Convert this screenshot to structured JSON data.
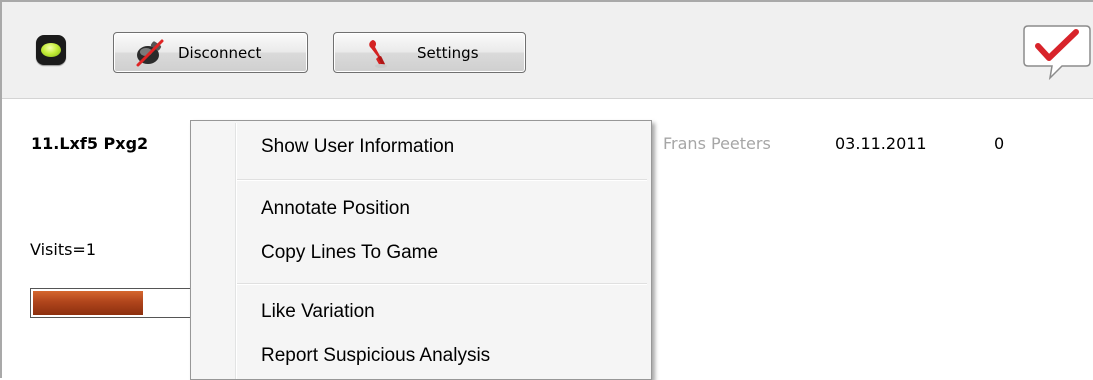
{
  "toolbar": {
    "status_led_color": "#b9e532",
    "disconnect_label": "Disconnect",
    "settings_label": "Settings",
    "check_icon_color": "#d8232a"
  },
  "analysis": {
    "move": "11.Lxf5 Pxg2",
    "author": "Frans Peeters",
    "date": "03.11.2011",
    "score": "0",
    "visits": "Visits=1",
    "progress_fraction": 0.63,
    "progress_color": "#a63d17"
  },
  "context_menu": {
    "items": [
      {
        "label": "Show User Information"
      },
      {
        "label": "Annotate Position"
      },
      {
        "label": "Copy Lines To Game"
      },
      {
        "label": "Like Variation"
      },
      {
        "label": "Report Suspicious Analysis"
      }
    ]
  }
}
